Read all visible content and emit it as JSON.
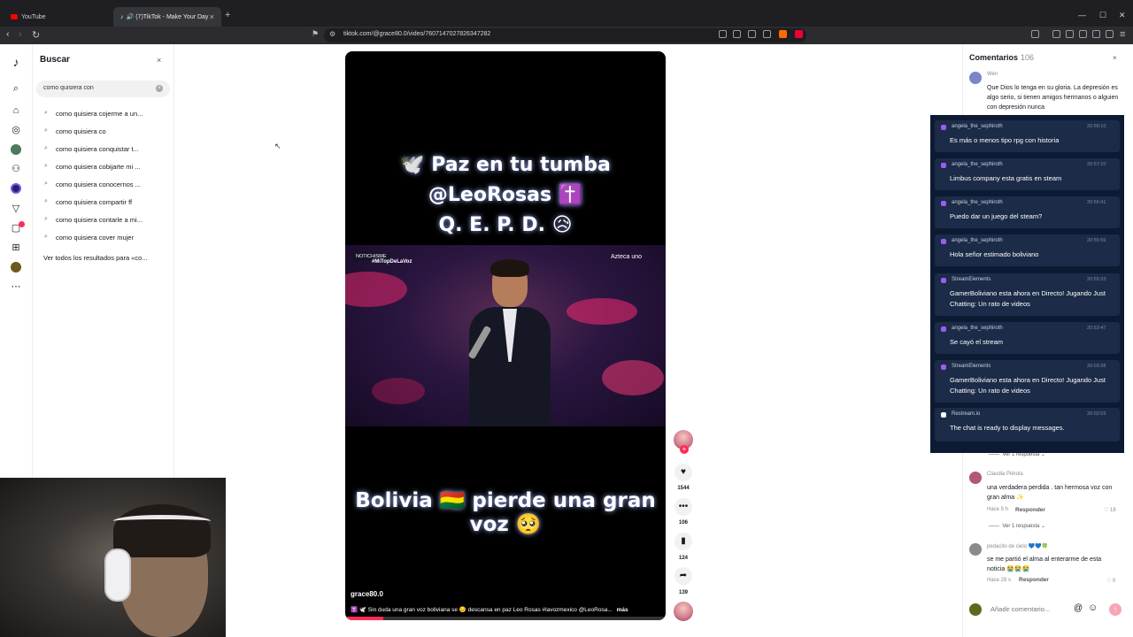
{
  "browser": {
    "tabs": [
      {
        "label": "YouTube",
        "active": false
      },
      {
        "label": "(7)TikTok - Make Your Day",
        "active": true
      }
    ],
    "url": "tiktok.com/@grace80.0/video/7607147027826347282",
    "new_tab": "+"
  },
  "search": {
    "title": "Buscar",
    "close": "×",
    "query": "como quisiera con",
    "suggestions": [
      "como quisiera cojerme a un...",
      "como quisiera co",
      "como quisiera conquistar t...",
      "como quisiera cobijarte mi ...",
      "como quisiera conocernos ...",
      "como quisiera compartir ff",
      "como quisiera contarle a mi...",
      "como quisiera cover mujer"
    ],
    "see_all": "Ver todos los resultados para «co..."
  },
  "video": {
    "caption_top_line1": "🕊️ Paz en tu tumba @LeoRosas ✝️",
    "caption_top_line2": "Q. E. P. D. 😥",
    "badge_left": "NOTICHISME",
    "badge_hashtag": "#MiTopDeLaVoz",
    "badge_channel": "Azteca uno",
    "caption_bottom": "Bolivia 🇧🇴 pierde una gran voz 🥺",
    "author": "grace80.0",
    "description": "✝️ 🕊️ Sin duda una gran voz boliviana se 😔 descansa en paz Leo Rosas #lavozmexico @LeoRosa...",
    "more": "más",
    "progress": 0.12
  },
  "actions": {
    "likes": "1544",
    "comments": "106",
    "saves": "124",
    "shares": "139"
  },
  "comments": {
    "title": "Comentarios",
    "count": "106",
    "close": "×",
    "first": {
      "user": "Wen",
      "text": "Que Dios lo tenga en su gloria. La depresión es algo serio, si tienen amigos hermanos o alguien con depresión nunca"
    },
    "view_replies_1": "Ver 1 respuesta ⌄",
    "second": {
      "user": "Claudia Piérola",
      "text": "una verdadera perdida . tan hermosa voz con gran alma ✨",
      "time": "Hace 5 h",
      "reply": "Responder",
      "likes": "18"
    },
    "view_replies_2": "Ver 1 respuesta ⌄",
    "third": {
      "user": "pedacito de cielo 💙💙🍀",
      "text": "se me partió el alma al enterarme de esta noticia 😭😭😭",
      "time": "Hace 29 s",
      "reply": "Responder",
      "likes": "0"
    },
    "input_placeholder": "Añadir comentario...",
    "at": "@",
    "emoji": "☺"
  },
  "stream_chat": [
    {
      "user": "angela_the_sephiroth",
      "time": "20:58:10",
      "text": "Es más o menos tipo rpg con historia"
    },
    {
      "user": "angela_the_sephiroth",
      "time": "20:57:10",
      "text": "Limbus company esta gratis en steam"
    },
    {
      "user": "angela_the_sephiroth",
      "time": "20:56:41",
      "text": "Puedo dar un juego del steam?"
    },
    {
      "user": "angela_the_sephiroth",
      "time": "20:55:56",
      "text": "Hola señor estimado boliviano"
    },
    {
      "user": "StreamElements",
      "time": "20:55:33",
      "text": "GamerBoliviano esta ahora en Directo! Jugando Just Chatting: Un rato de videos"
    },
    {
      "user": "angela_the_sephiroth",
      "time": "20:53:47",
      "text": "Se cayó el stream"
    },
    {
      "user": "StreamElements",
      "time": "20:03:38",
      "text": "GamerBoliviano esta ahora en Directo! Jugando Just Chatting: Un rato de videos"
    },
    {
      "user": "Restream.io",
      "time": "20:02:03",
      "text": "The chat is ready to display messages."
    }
  ],
  "colors": {
    "tiktok_red": "#fe2c55",
    "chat_bg": "#0d1a33",
    "chat_card": "#1c2b47"
  }
}
